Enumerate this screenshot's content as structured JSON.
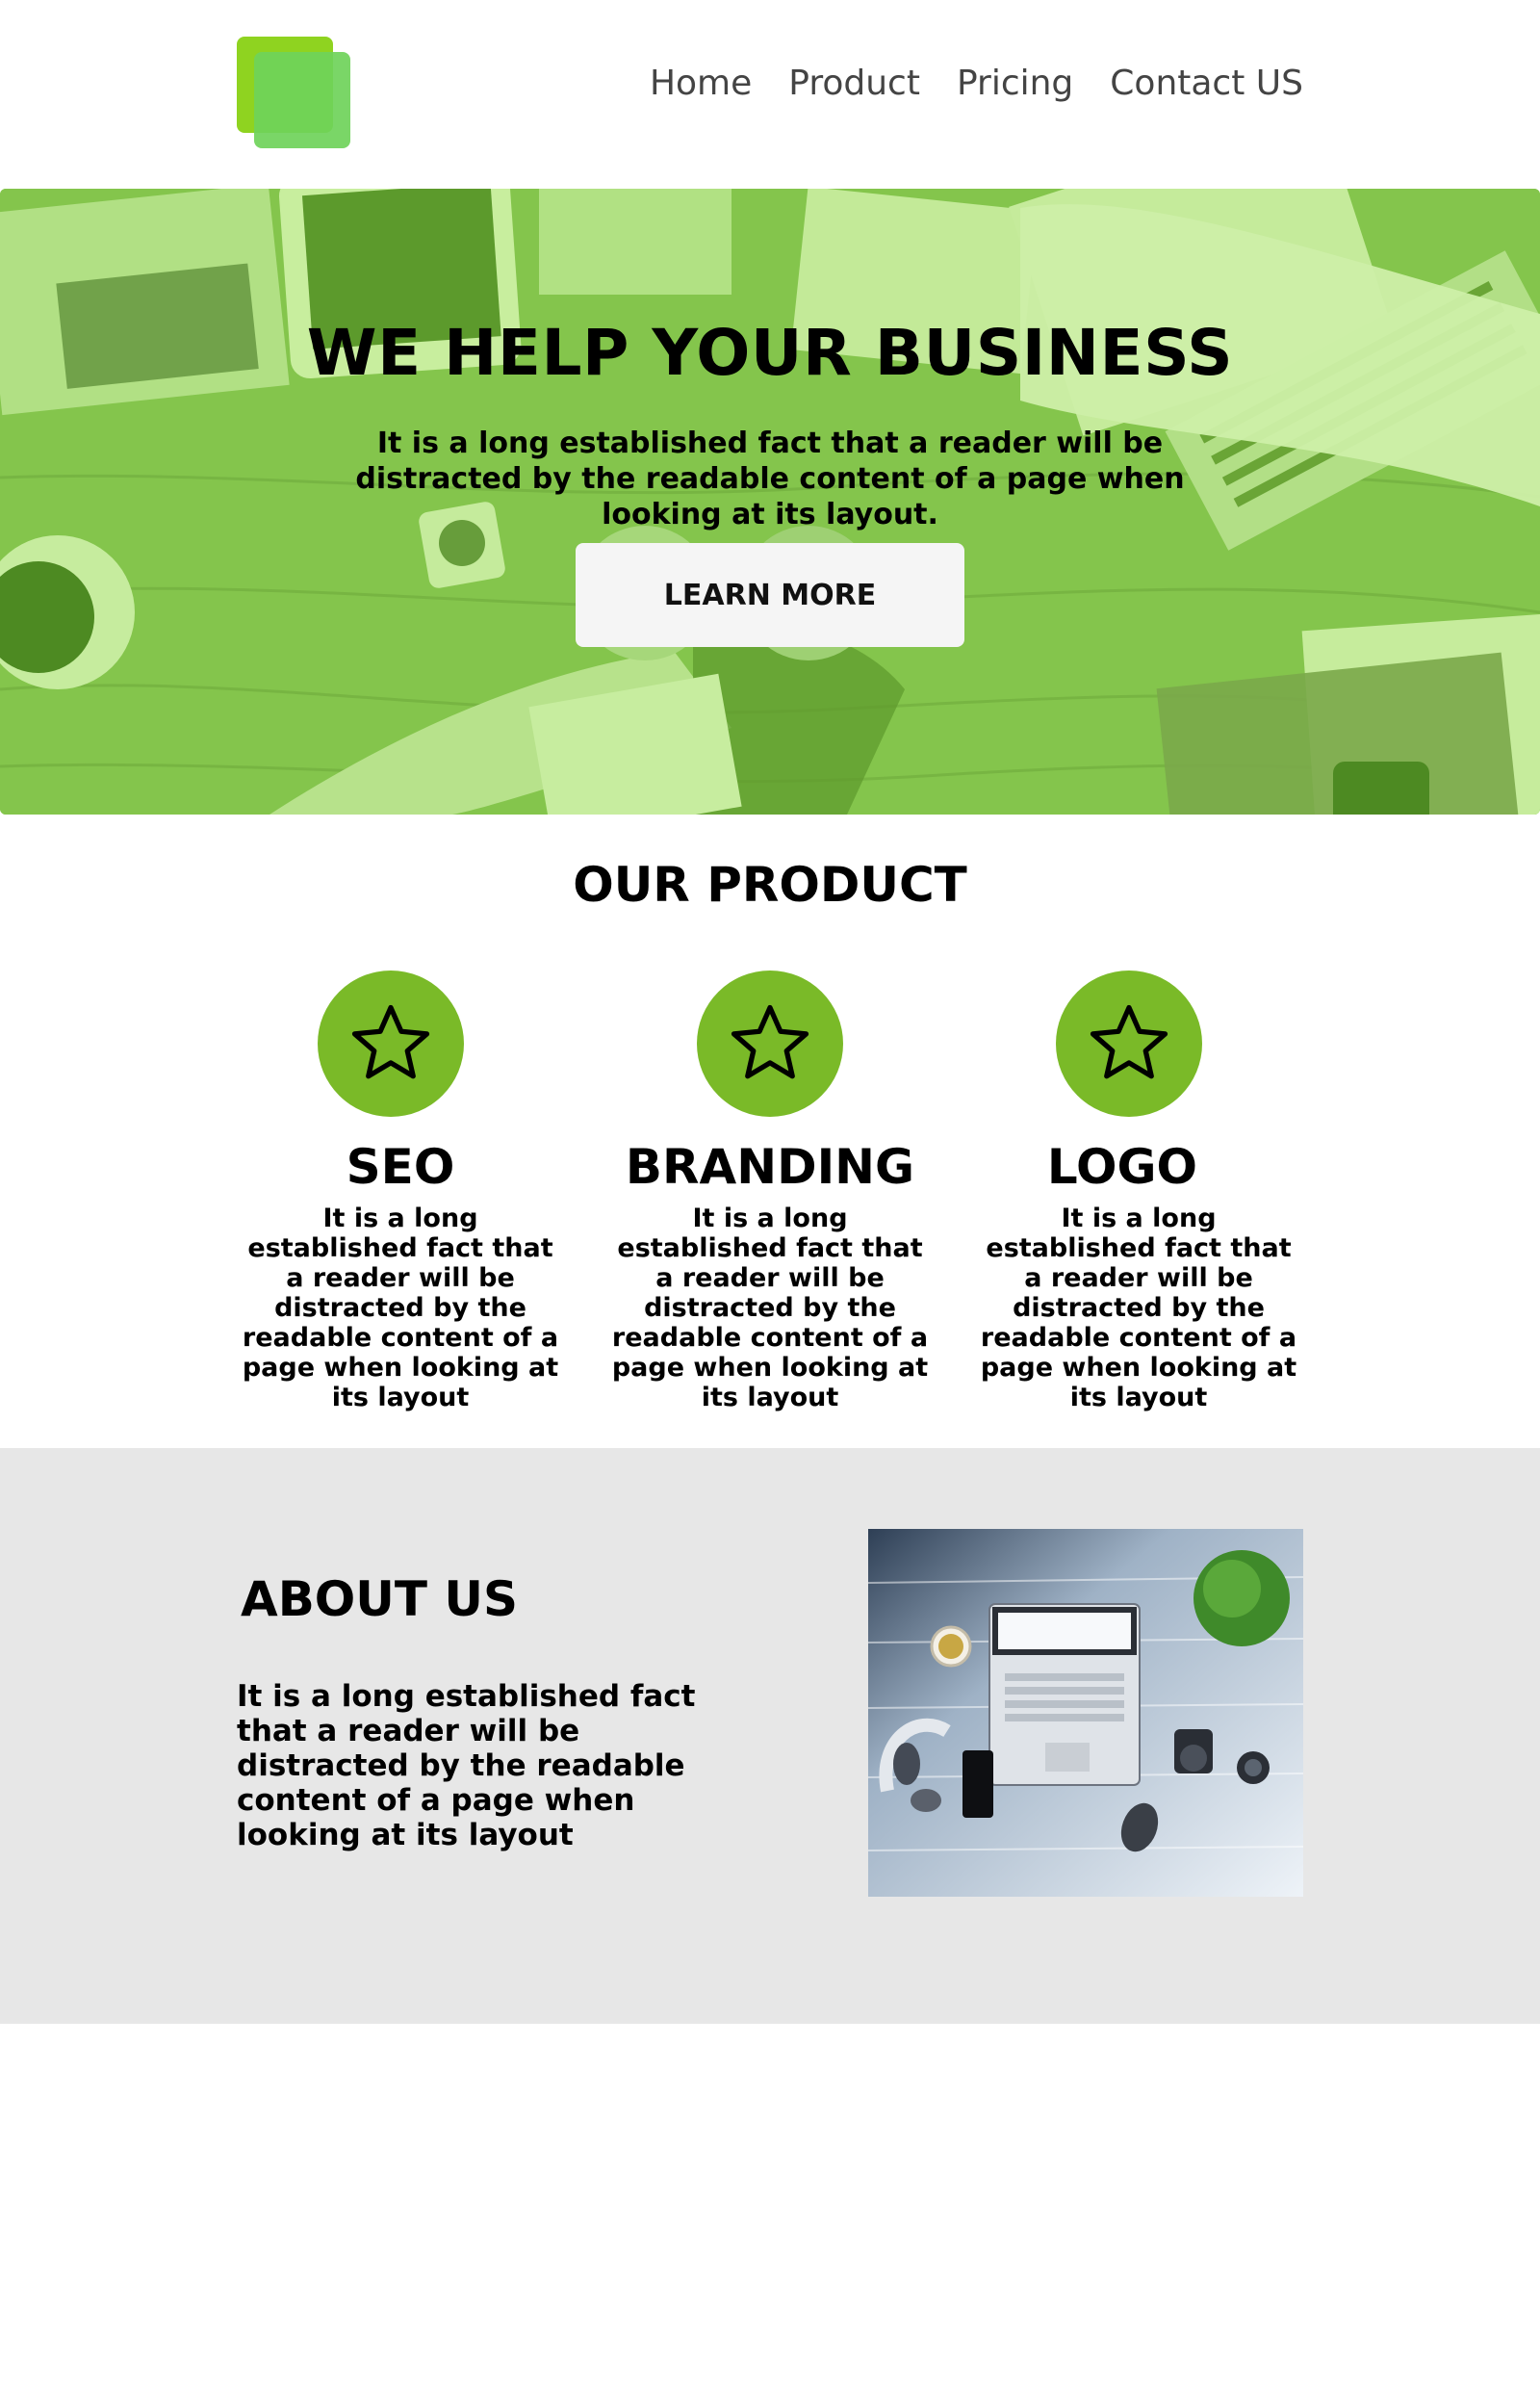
{
  "nav": {
    "logo": "logo",
    "items": [
      {
        "label": "Home"
      },
      {
        "label": "Product"
      },
      {
        "label": "Pricing"
      },
      {
        "label": "Contact US"
      }
    ]
  },
  "hero": {
    "title": "WE HELP YOUR BUSINESS",
    "subtitle": "It is a long established fact that a reader will be distracted by the readable content of a page when looking at its layout.",
    "button": "LEARN MORE",
    "overlay_color": "#83c44a"
  },
  "products": {
    "title": "OUR PRODUCT",
    "icon": "star-icon",
    "accent": "#7aba28",
    "items": [
      {
        "title": "SEO",
        "text": "It is a long established fact that a reader will be distracted by the readable content of a page when looking at its layout"
      },
      {
        "title": "BRANDING",
        "text": "It is a long established fact that a reader will be distracted by the readable content of a page when looking at its layout"
      },
      {
        "title": "LOGO",
        "text": "It is a long established fact that a reader will be distracted by the readable content of a page when looking at its layout"
      }
    ]
  },
  "about": {
    "title": "ABOUT US",
    "text": "It is a long established fact that a reader will be distracted by the readable content of a page when looking at its layout",
    "background": "#e7e7e7"
  }
}
